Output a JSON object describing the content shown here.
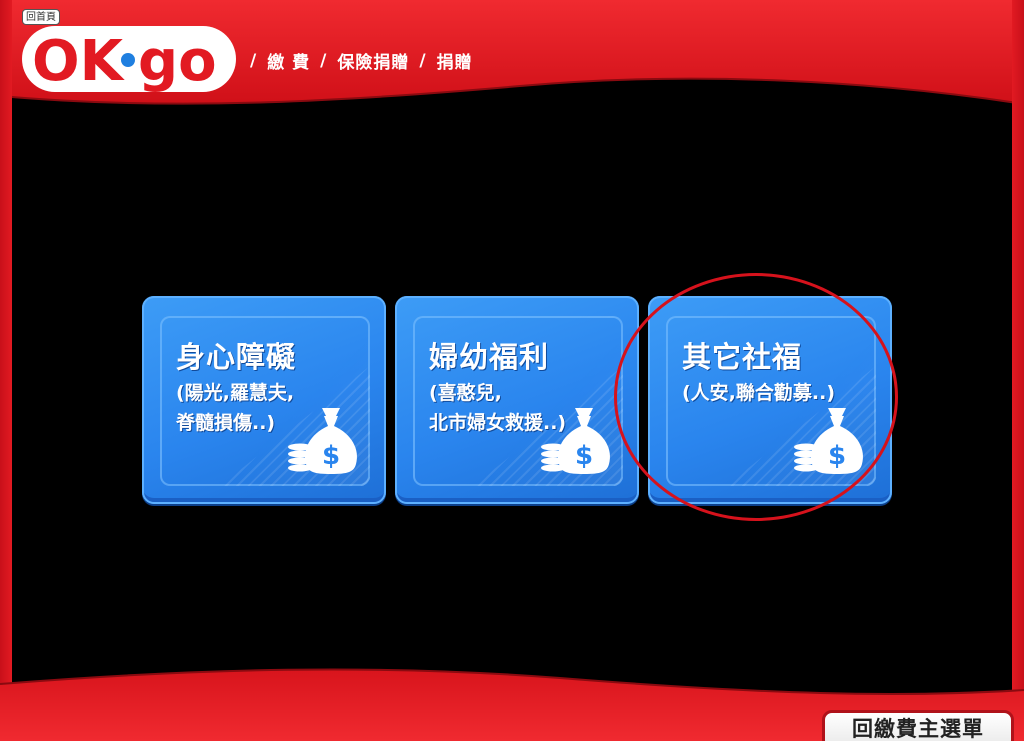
{
  "header": {
    "home_badge": "回首頁",
    "logo": {
      "left": "OK",
      "right": "go"
    },
    "breadcrumb": [
      "繳 費",
      "保險捐贈",
      "捐贈"
    ],
    "separator": "/"
  },
  "tiles": [
    {
      "title": "身心障礙",
      "lines": [
        "(陽光,羅慧夫,",
        "脊髓損傷..)"
      ],
      "icon": "money-bag-icon"
    },
    {
      "title": "婦幼福利",
      "lines": [
        "(喜憨兒,",
        "北市婦女救援..)"
      ],
      "icon": "money-bag-icon"
    },
    {
      "title": "其它社福",
      "lines": [
        "(人安,聯合勸募..)",
        ""
      ],
      "icon": "money-bag-icon"
    }
  ],
  "footer": {
    "back_button": "回繳費主選單"
  },
  "colors": {
    "brand_red": "#e21a22",
    "tile_blue": "#2a85ee",
    "highlight": "#d6121c"
  }
}
